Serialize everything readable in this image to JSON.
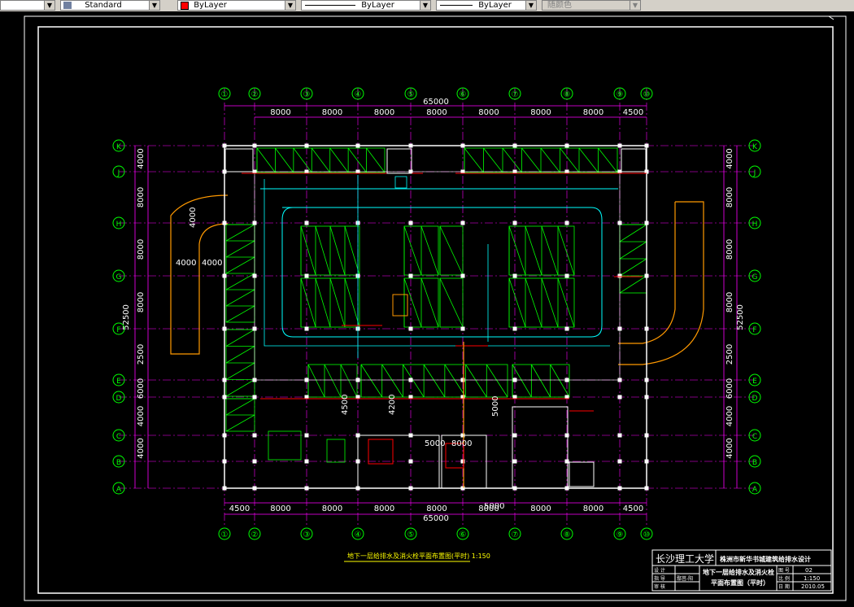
{
  "toolbar": {
    "dropdown_arrow": "▼",
    "text_style": "Standard",
    "layer_color": "ByLayer",
    "linetype": "ByLayer",
    "lineweight": "ByLayer",
    "plot_style": "随颜色",
    "colors": {
      "swatch": "#ff0000",
      "bg": "#d4d0c8"
    }
  },
  "drawing": {
    "grid_cols": [
      "①",
      "②",
      "③",
      "④",
      "⑤",
      "⑥",
      "⑦",
      "⑧",
      "⑨",
      "⑩"
    ],
    "grid_rows": [
      "K",
      "J",
      "H",
      "G",
      "F",
      "E",
      "D",
      "C",
      "B",
      "A"
    ],
    "top_dims": [
      "8000",
      "8000",
      "8000",
      "8000",
      "8000",
      "8000",
      "8000",
      "4500"
    ],
    "top_total": "65000",
    "bottom_dims": [
      "4500",
      "8000",
      "8000",
      "8000",
      "8000",
      "8000",
      "8000",
      "8000",
      "4500"
    ],
    "bottom_total": "65000",
    "left_dims": [
      "4000",
      "8000",
      "8000",
      "8000",
      "2500",
      "6000",
      "4000",
      "4000"
    ],
    "left_total": "52500",
    "right_dims": [
      "4000",
      "8000",
      "8000",
      "8000",
      "2500",
      "6000",
      "4000",
      "4000"
    ],
    "right_total": "52500",
    "ramp_dims": [
      "4000",
      "4000"
    ],
    "ramp_width": "4000",
    "inner_dims": [
      "4500",
      "4200",
      "5000",
      "5000",
      "8000",
      "5000"
    ],
    "plan_title": "地下一层给排水及消火栓平面布置图(平时) 1:150",
    "colors": {
      "grid": "#ff00ff",
      "bubble": "#00ff00",
      "pipe": "#00ffff",
      "wall": "#ffffff",
      "frame": "#ffffff",
      "parking": "#00ff00",
      "ramp": "#ff9900",
      "red": "#ff0000",
      "yellow": "#ffff00"
    }
  },
  "title_block": {
    "school": "长沙理工大学",
    "project": "株洲市新华书城建筑给排水设计",
    "drawing_name_1": "地下一层给排水及消火栓",
    "drawing_name_2": "平面布置图（平时）",
    "fields": [
      {
        "label": "设 计",
        "value": ""
      },
      {
        "label": "指 导",
        "value": "鄢莒-阳"
      },
      {
        "label": "审 核",
        "value": ""
      }
    ],
    "meta": [
      {
        "label": "图 号",
        "value": "02"
      },
      {
        "label": "比 例",
        "value": "1:150"
      },
      {
        "label": "日 期",
        "value": "2010.05"
      }
    ]
  }
}
